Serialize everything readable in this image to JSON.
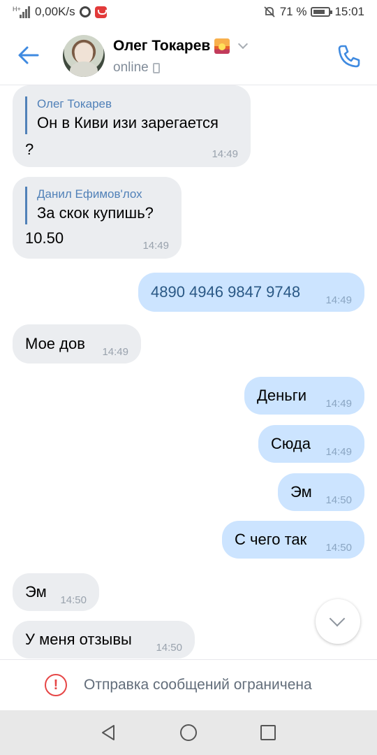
{
  "status_bar": {
    "signal_label": "H+",
    "speed": "0,00K/s",
    "battery": "71 %",
    "time": "15:01"
  },
  "header": {
    "name": "Олег Токарев",
    "status": "online",
    "icons": {
      "back": "arrow-left-icon",
      "call": "phone-icon"
    }
  },
  "messages": [
    {
      "dir": "in",
      "reply_author": "Олег Токарев",
      "reply_text": "Он в Киви изи зарегается",
      "text": "?",
      "time": "14:49"
    },
    {
      "dir": "in",
      "reply_author": "Данил Ефимов'лох",
      "reply_text": "За скок купишь?",
      "text": "10.50",
      "time": "14:49"
    },
    {
      "dir": "out",
      "text": "4890 4946 9847 9748",
      "time": "14:49"
    },
    {
      "dir": "in",
      "text": "Мое дов",
      "time": "14:49"
    },
    {
      "dir": "out",
      "text": "Деньги",
      "time": "14:49"
    },
    {
      "dir": "out",
      "text": "Сюда",
      "time": "14:49"
    },
    {
      "dir": "out",
      "text": "Эм",
      "time": "14:50"
    },
    {
      "dir": "out",
      "text": "С чего так",
      "time": "14:50"
    },
    {
      "dir": "in",
      "text": "Эм",
      "time": "14:50"
    },
    {
      "dir": "in",
      "text": "У меня отзывы",
      "time": "14:50"
    }
  ],
  "restriction": {
    "text": "Отправка сообщений ограничена",
    "icon": "warning-circle-icon",
    "color": "#e64646"
  },
  "colors": {
    "accent": "#5181b8",
    "incoming_bubble": "#ebedf0",
    "outgoing_bubble": "#cce4ff"
  }
}
